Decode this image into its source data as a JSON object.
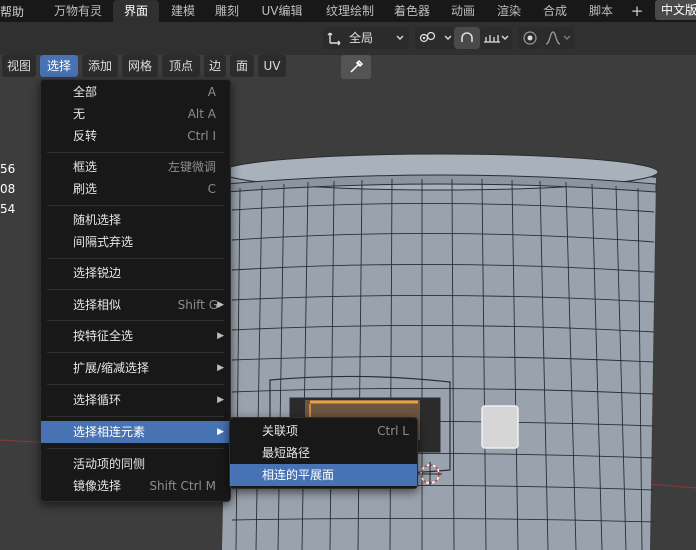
{
  "topbar": {
    "help_label": "帮助",
    "tabs": [
      "万物有灵",
      "界面",
      "建模",
      "雕刻",
      "UV编辑",
      "纹理绘制",
      "着色器",
      "动画",
      "渲染",
      "合成",
      "脚本"
    ],
    "active_tab": "界面",
    "plus_label": "+",
    "language": "中文版"
  },
  "header": {
    "orientation_label": "全局"
  },
  "menubar": {
    "items": [
      "视图",
      "选择",
      "添加",
      "网格",
      "顶点",
      "边",
      "面",
      "UV"
    ],
    "active": "选择"
  },
  "stats": [
    "56",
    "08",
    "54"
  ],
  "select_menu": {
    "items": [
      {
        "label": "全部",
        "shortcut": "A"
      },
      {
        "label": "无",
        "shortcut": "Alt A"
      },
      {
        "label": "反转",
        "shortcut": "Ctrl I"
      },
      {
        "label": "框选",
        "shortcut": "左键微调"
      },
      {
        "label": "刷选",
        "shortcut": "C"
      },
      {
        "label": "随机选择",
        "shortcut": ""
      },
      {
        "label": "间隔式弃选",
        "shortcut": ""
      },
      {
        "label": "选择锐边",
        "shortcut": ""
      },
      {
        "label": "选择相似",
        "shortcut": "Shift G"
      },
      {
        "label": "按特征全选",
        "shortcut": ""
      },
      {
        "label": "扩展/缩减选择",
        "shortcut": ""
      },
      {
        "label": "选择循环",
        "shortcut": ""
      },
      {
        "label": "选择相连元素",
        "shortcut": ""
      },
      {
        "label": "活动项的同侧",
        "shortcut": ""
      },
      {
        "label": "镜像选择",
        "shortcut": "Shift Ctrl M"
      }
    ],
    "highlighted": "选择相连元素"
  },
  "linked_submenu": {
    "items": [
      {
        "label": "关联项",
        "shortcut": "Ctrl L"
      },
      {
        "label": "最短路径",
        "shortcut": ""
      },
      {
        "label": "相连的平展面",
        "shortcut": ""
      }
    ],
    "highlighted": "相连的平展面"
  },
  "colors": {
    "accent": "#4772b3",
    "menu_bg": "#181818",
    "viewport_bg": "#3d3d3d",
    "mesh": "#9aa3ad",
    "wire": "#2a2e33",
    "selected_edge": "#e8a040"
  }
}
